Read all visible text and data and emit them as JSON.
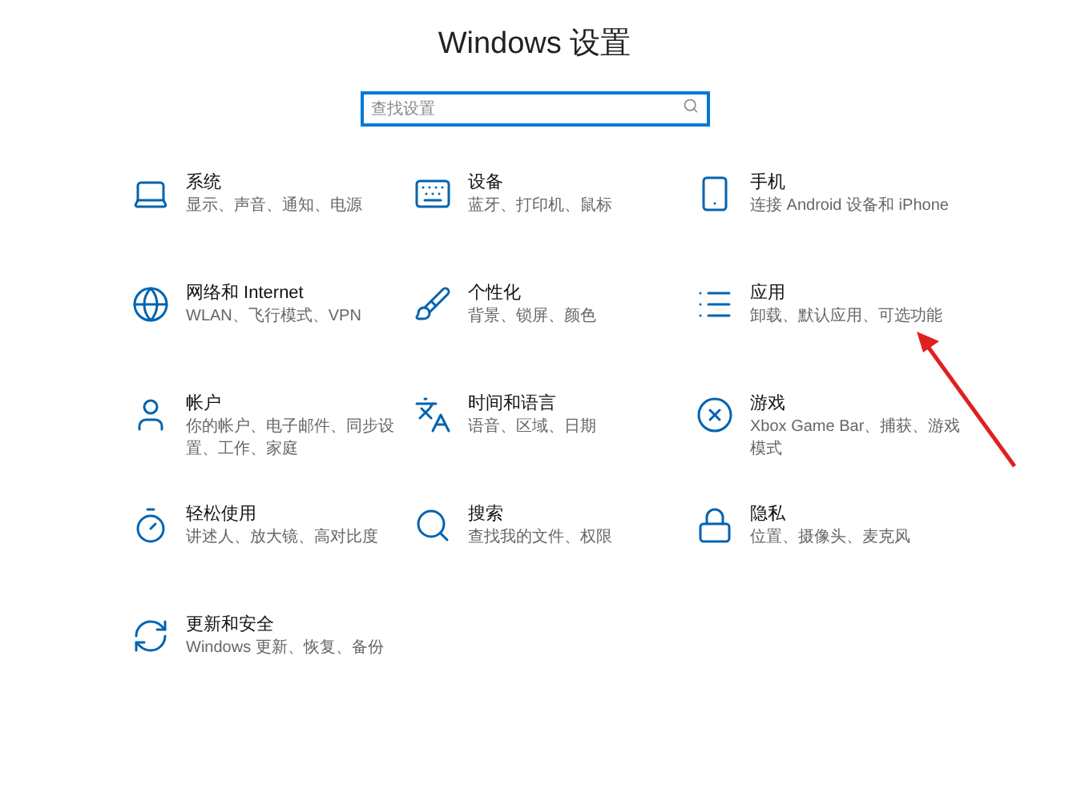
{
  "window": {
    "title": "Windows 设置"
  },
  "search": {
    "placeholder": "查找设置"
  },
  "items": [
    {
      "title": "系统",
      "subtitle": "显示、声音、通知、电源"
    },
    {
      "title": "设备",
      "subtitle": "蓝牙、打印机、鼠标"
    },
    {
      "title": "手机",
      "subtitle": "连接 Android 设备和 iPhone"
    },
    {
      "title": "网络和 Internet",
      "subtitle": "WLAN、飞行模式、VPN"
    },
    {
      "title": "个性化",
      "subtitle": "背景、锁屏、颜色"
    },
    {
      "title": "应用",
      "subtitle": "卸载、默认应用、可选功能"
    },
    {
      "title": "帐户",
      "subtitle": "你的帐户、电子邮件、同步设置、工作、家庭"
    },
    {
      "title": "时间和语言",
      "subtitle": "语音、区域、日期"
    },
    {
      "title": "游戏",
      "subtitle": "Xbox Game Bar、捕获、游戏模式"
    },
    {
      "title": "轻松使用",
      "subtitle": "讲述人、放大镜、高对比度"
    },
    {
      "title": "搜索",
      "subtitle": "查找我的文件、权限"
    },
    {
      "title": "隐私",
      "subtitle": "位置、摄像头、麦克风"
    },
    {
      "title": "更新和安全",
      "subtitle": "Windows 更新、恢复、备份"
    }
  ]
}
